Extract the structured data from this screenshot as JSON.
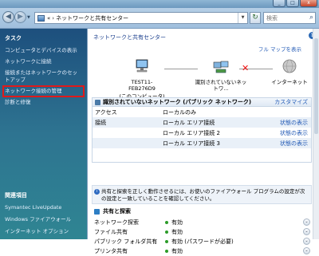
{
  "window": {
    "min": "_",
    "max": "□",
    "close": "x"
  },
  "address": {
    "root": "«",
    "path": "ネットワークと共有センター",
    "search_placeholder": "検索"
  },
  "sidebar": {
    "task_header": "タスク",
    "tasks": [
      {
        "label": "コンピュータとデバイスの表示"
      },
      {
        "label": "ネットワークに接続"
      },
      {
        "label": "接続またはネットワークのセットアップ"
      },
      {
        "label": "ネットワーク接続の管理",
        "highlighted": true
      },
      {
        "label": "診断と修復"
      }
    ],
    "related_header": "関連項目",
    "related": [
      {
        "label": "Symantec LiveUpdate"
      },
      {
        "label": "Windows ファイアウォール"
      },
      {
        "label": "インターネット オプション"
      }
    ]
  },
  "main": {
    "title": "ネットワークと共有センター",
    "full_map": "フル マップを表示",
    "nodes": {
      "pc_name": "TEST11-FEB276D9",
      "pc_sub": "(このコンピュータ)",
      "unknown": "識別されていないネットワ...",
      "internet": "インターネット"
    },
    "network_box": {
      "header": "識別されていないネットワーク (パブリック ネットワーク)",
      "customize": "カスタマイズ",
      "access_label": "アクセス",
      "access_value": "ローカルのみ",
      "conn_label": "接続",
      "connections": [
        {
          "name": "ローカル エリア接続",
          "status": "状態の表示"
        },
        {
          "name": "ローカル エリア接続 2",
          "status": "状態の表示"
        },
        {
          "name": "ローカル エリア接続 3",
          "status": "状態の表示"
        }
      ]
    },
    "notice": "共有と探索を正しく動作させるには、お使いのファイアウォール プログラムの設定が次の設定と一致していることを確認してください。",
    "sharing": {
      "header": "共有と探索",
      "rows": [
        {
          "label": "ネットワーク探索",
          "value": "有効"
        },
        {
          "label": "ファイル共有",
          "value": "有効"
        },
        {
          "label": "パブリック フォルダ共有",
          "value": "有効 (パスワードが必要)"
        },
        {
          "label": "プリンタ共有",
          "value": "有効"
        }
      ]
    }
  },
  "colors": {
    "highlight": "#e01a1a",
    "link": "#2159b5",
    "status_on": "#2c9b28"
  }
}
